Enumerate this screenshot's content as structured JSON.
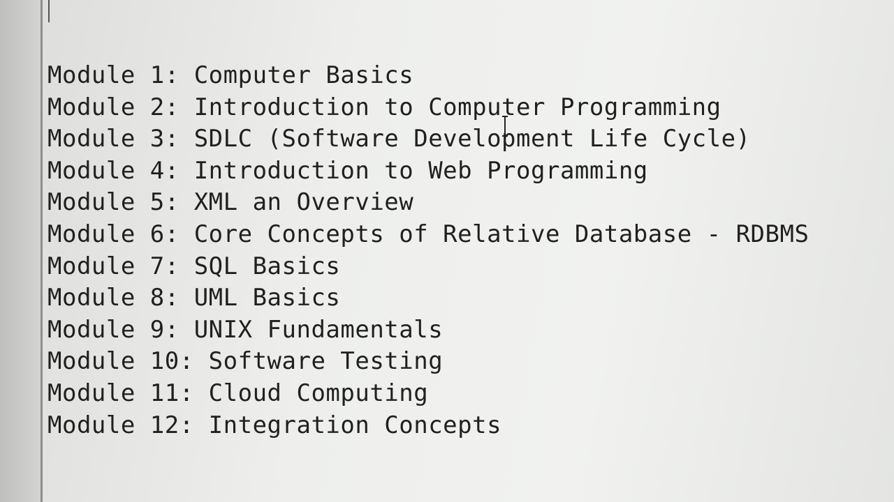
{
  "editor": {
    "lines": [
      "Module 1: Computer Basics",
      "Module 2: Introduction to Computer Programming",
      "Module 3: SDLC (Software Development Life Cycle)",
      "Module 4: Introduction to Web Programming",
      "Module 5: XML an Overview",
      "Module 6: Core Concepts of Relative Database - RDBMS",
      "Module 7: SQL Basics",
      "Module 8: UML Basics",
      "Module 9: UNIX Fundamentals",
      "Module 10: Software Testing",
      "Module 11: Cloud Computing",
      "Module 12: Integration Concepts"
    ],
    "cursor_icon": "text-cursor-icon"
  }
}
